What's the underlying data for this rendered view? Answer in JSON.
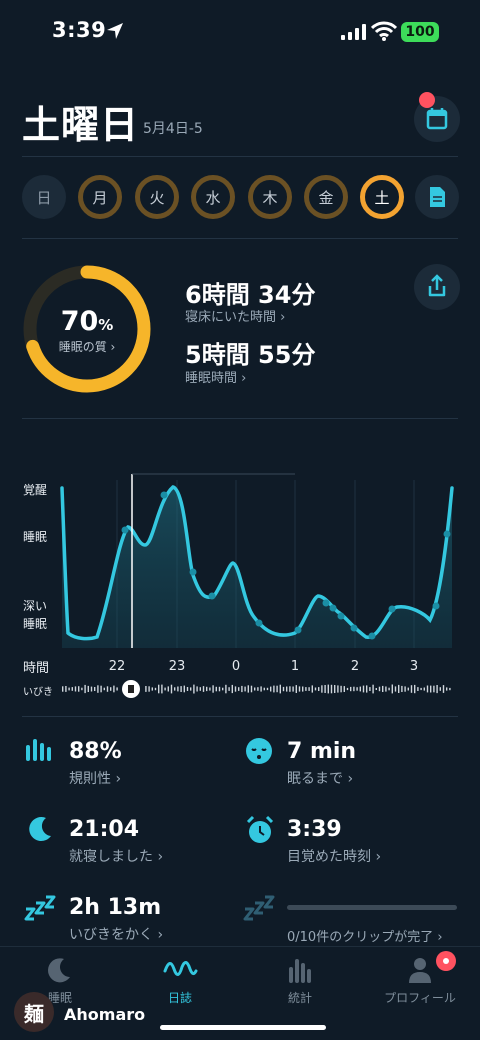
{
  "status_bar": {
    "time": "3:39",
    "battery": "100"
  },
  "header": {
    "title": "土曜日",
    "subtitle": "5月4日-5"
  },
  "week": [
    "日",
    "月",
    "火",
    "水",
    "木",
    "金",
    "土"
  ],
  "summary": {
    "quality_value": "70",
    "quality_unit": "%",
    "quality_label": "睡眠の質 ›",
    "quality_fraction": 0.7,
    "in_bed_value": "6時間 34分",
    "in_bed_label": "寝床にいた時間 ›",
    "asleep_value": "5時間 55分",
    "asleep_label": "睡眠時間 ›"
  },
  "chart": {
    "y_labels": [
      "覚醒",
      "睡眠",
      "深い\n睡眠"
    ],
    "x_label": "時間",
    "snore_label": "いびき",
    "x_ticks": [
      "22",
      "23",
      "0",
      "1",
      "2",
      "3"
    ]
  },
  "chart_data": {
    "type": "area",
    "y_categories": [
      "深い睡眠",
      "睡眠",
      "覚醒"
    ],
    "x_ticks": [
      "22",
      "23",
      "0",
      "1",
      "2",
      "3"
    ]
  },
  "metrics": [
    {
      "value": "88%",
      "label": "規則性 ›",
      "icon": "regularity-icon"
    },
    {
      "value": "7 min",
      "label": "眠るまで ›",
      "icon": "sleepy-face-icon"
    },
    {
      "value": "21:04",
      "label": "就寝しました ›",
      "icon": "moon-icon"
    },
    {
      "value": "3:39",
      "label": "目覚めた時刻 ›",
      "icon": "alarm-clock-icon"
    },
    {
      "value": "2h 13m",
      "label": "いびきをかく ›",
      "icon": "snore-icon"
    },
    {
      "value": "",
      "label": "0/10件のクリップが完了 ›",
      "icon": "snore-clips-icon"
    }
  ],
  "tabs": [
    {
      "label": "睡眠",
      "icon": "moon-icon",
      "active": false
    },
    {
      "label": "日誌",
      "icon": "wave-icon",
      "active": true
    },
    {
      "label": "統計",
      "icon": "bars-icon",
      "active": false
    },
    {
      "label": "プロフィール",
      "icon": "person-icon",
      "active": false
    }
  ],
  "watermark": {
    "text": "Ahomaro",
    "logo": "麺"
  },
  "colors": {
    "background": "#0f1b27",
    "accent": "#34c8e0",
    "orange": "#f3a331",
    "badge": "#ff5260"
  }
}
